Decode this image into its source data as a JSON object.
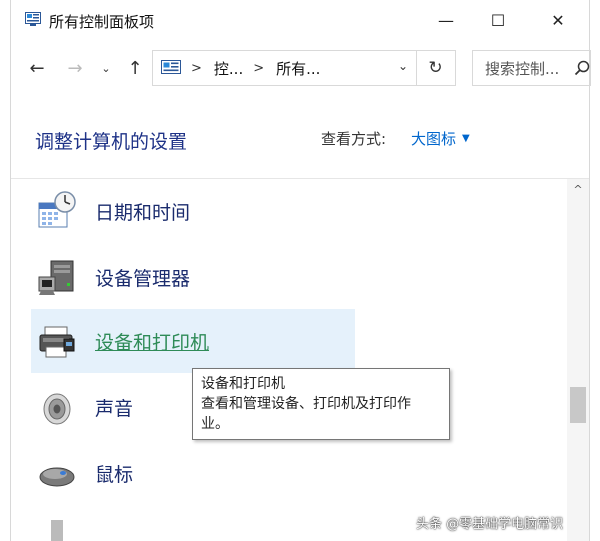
{
  "window": {
    "title": "所有控制面板项",
    "minimize_glyph": "—",
    "maximize_glyph": "☐",
    "close_glyph": "✕"
  },
  "nav": {
    "back_glyph": "←",
    "forward_glyph": "→",
    "recent_glyph": "⌄",
    "up_glyph": "↑",
    "breadcrumbs": [
      "控...",
      "所有..."
    ],
    "crumb_separator": ">",
    "address_dropdown_glyph": "⌄",
    "refresh_glyph": "↻",
    "search_placeholder": "搜索控制..."
  },
  "header": {
    "title": "调整计算机的设置",
    "view_label": "查看方式:",
    "view_value": "大图标",
    "view_arrow": "▼"
  },
  "items": [
    {
      "label": "日期和时间",
      "icon": "calendar-clock-icon"
    },
    {
      "label": "设备管理器",
      "icon": "device-manager-icon"
    },
    {
      "label": "设备和打印机",
      "icon": "printer-icon"
    },
    {
      "label": "声音",
      "icon": "speaker-icon"
    },
    {
      "label": "鼠标",
      "icon": "mouse-icon"
    }
  ],
  "tooltip": {
    "line1": "设备和打印机",
    "line2": "查看和管理设备、打印机及打印作",
    "line3": "业。"
  },
  "scrollbar": {
    "up_glyph": "^"
  },
  "watermark": "头条 @零基础学电脑常识",
  "colors": {
    "title_blue": "#1e3287",
    "link_blue": "#0066cc",
    "hover_bg": "#e5f1fb",
    "hover_text": "#2e8b57"
  }
}
